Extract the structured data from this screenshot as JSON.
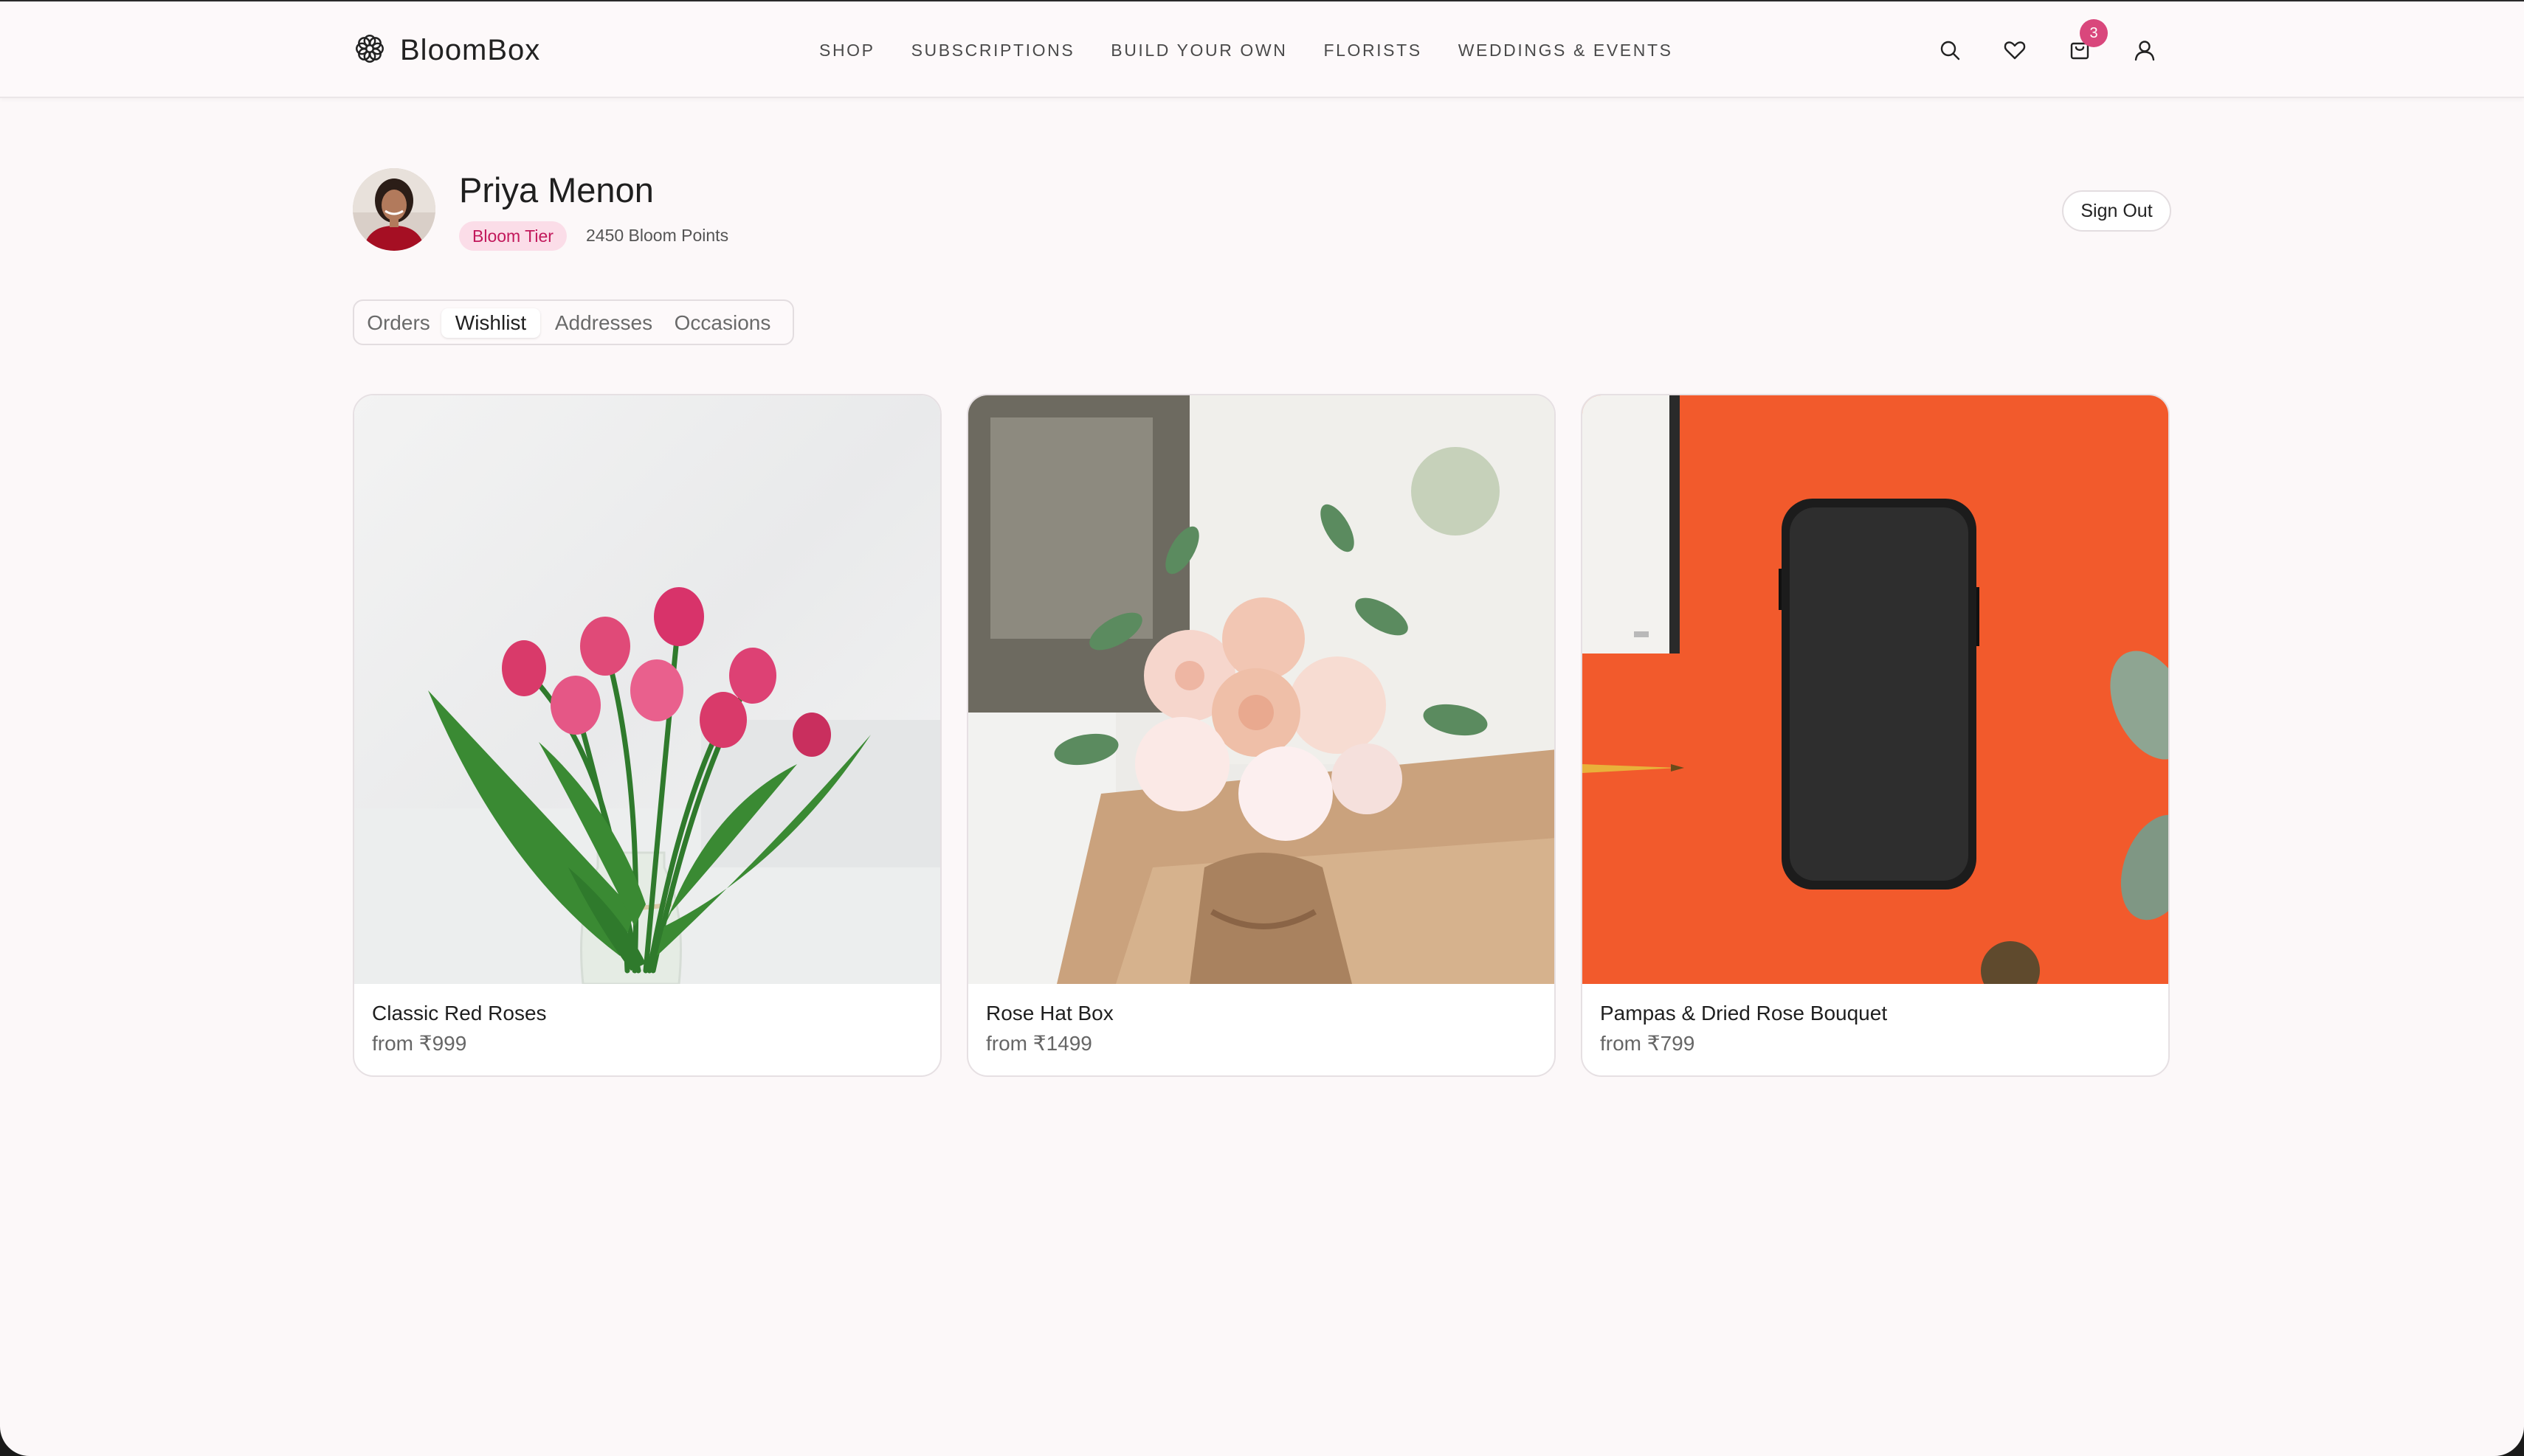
{
  "brand": {
    "name": "BloomBox",
    "icon": "flower-logo-icon"
  },
  "nav": {
    "items": [
      {
        "label": "SHOP"
      },
      {
        "label": "SUBSCRIPTIONS"
      },
      {
        "label": "BUILD YOUR OWN"
      },
      {
        "label": "FLORISTS"
      },
      {
        "label": "WEDDINGS & EVENTS"
      }
    ]
  },
  "header_icons": {
    "search": "search-icon",
    "wishlist": "heart-icon",
    "cart": "shopping-bag-icon",
    "account": "user-icon",
    "cart_count": "3"
  },
  "profile": {
    "name": "Priya Menon",
    "tier": "Bloom Tier",
    "points": "2450 Bloom Points",
    "sign_out": "Sign Out"
  },
  "tabs": [
    {
      "label": "Orders",
      "active": false
    },
    {
      "label": "Wishlist",
      "active": true
    },
    {
      "label": "Addresses",
      "active": false
    },
    {
      "label": "Occasions",
      "active": false
    }
  ],
  "wishlist": [
    {
      "name": "Classic Red Roses",
      "price": "from ₹999"
    },
    {
      "name": "Rose Hat Box",
      "price": "from ₹1499"
    },
    {
      "name": "Pampas & Dried Rose Bouquet",
      "price": "from ₹799"
    }
  ],
  "colors": {
    "accent": "#d9477c",
    "tier_bg": "#fbdde8",
    "tier_text": "#c2185b",
    "page_bg": "#fcf8f9"
  }
}
